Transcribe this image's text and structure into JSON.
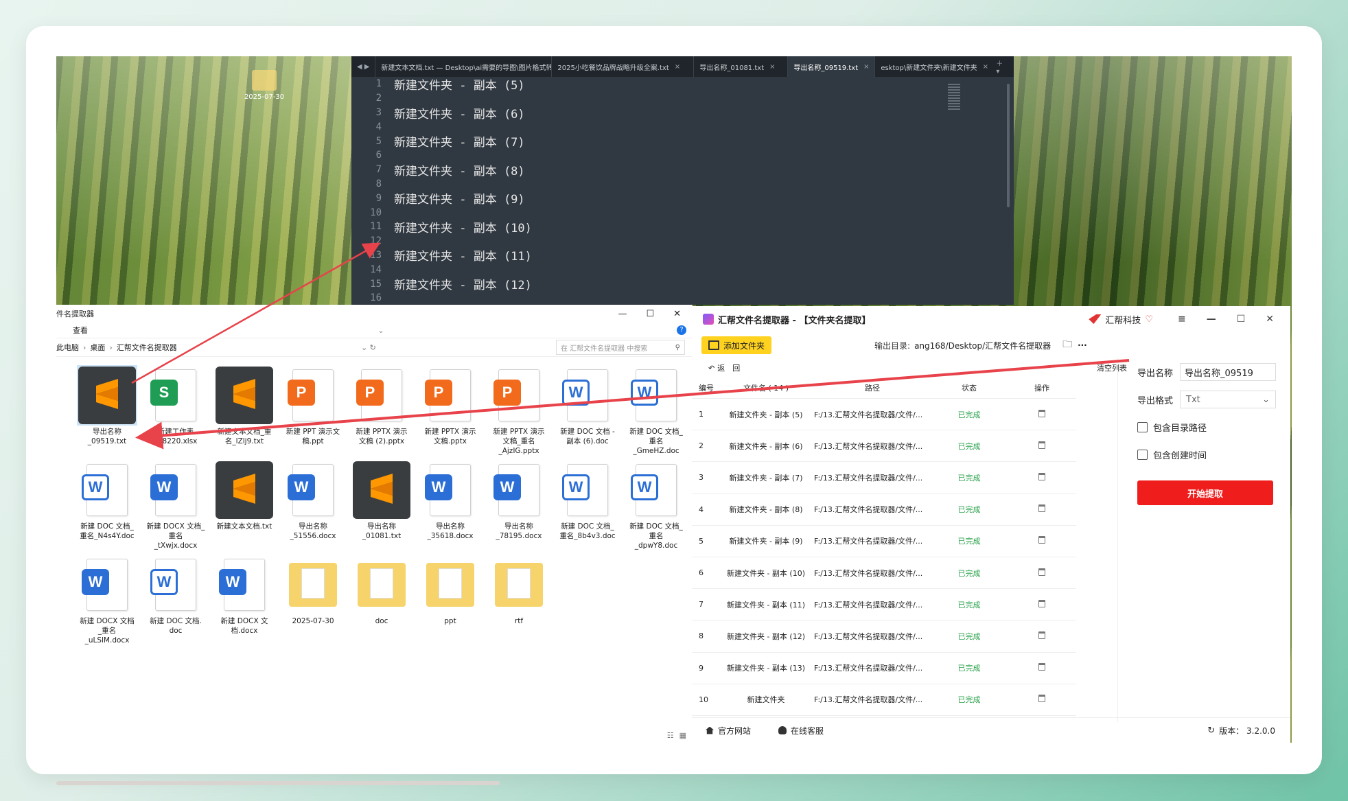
{
  "desktop": {
    "icon_label": "2025-07-30"
  },
  "editor": {
    "tabs": [
      "新建文本文档.txt — Desktop\\ai需要的导图\\图片格式转",
      "2025小吃餐饮品牌战略升级全案.txt",
      "导出名称_01081.txt",
      "导出名称_09519.txt",
      "esktop\\新建文件夹\\新建文件夹"
    ],
    "active_tab": 3,
    "lines": [
      {
        "n": "1",
        "t": "新建文件夹 - 副本 (5)"
      },
      {
        "n": "2",
        "t": ""
      },
      {
        "n": "3",
        "t": "新建文件夹 - 副本 (6)"
      },
      {
        "n": "4",
        "t": ""
      },
      {
        "n": "5",
        "t": "新建文件夹 - 副本 (7)"
      },
      {
        "n": "6",
        "t": ""
      },
      {
        "n": "7",
        "t": "新建文件夹 - 副本 (8)"
      },
      {
        "n": "8",
        "t": ""
      },
      {
        "n": "9",
        "t": "新建文件夹 - 副本 (9)"
      },
      {
        "n": "10",
        "t": ""
      },
      {
        "n": "11",
        "t": "新建文件夹 - 副本 (10)"
      },
      {
        "n": "12",
        "t": ""
      },
      {
        "n": "13",
        "t": "新建文件夹 - 副本 (11)"
      },
      {
        "n": "14",
        "t": ""
      },
      {
        "n": "15",
        "t": "新建文件夹 - 副本 (12)"
      },
      {
        "n": "16",
        "t": ""
      }
    ]
  },
  "explorer": {
    "title": "件名提取器",
    "menu_view": "查看",
    "breadcrumb": [
      "此电脑",
      "桌面",
      "汇帮文件名提取器"
    ],
    "search_placeholder": "在 汇帮文件名提取器 中搜索",
    "files": [
      {
        "kind": "sublime",
        "name": "导出名称\n_09519.txt",
        "selected": true
      },
      {
        "kind": "s",
        "name": "新建工作表\n_28220.xlsx"
      },
      {
        "kind": "sublime",
        "name": "新建文本文档_重\n名_lZlj9.txt"
      },
      {
        "kind": "p",
        "name": "新建 PPT 演示文\n稿.ppt"
      },
      {
        "kind": "p",
        "name": "新建 PPTX 演示\n文稿 (2).pptx"
      },
      {
        "kind": "p",
        "name": "新建 PPTX 演示\n文稿.pptx"
      },
      {
        "kind": "p",
        "name": "新建 PPTX 演示\n文稿_重名\n_AjzIG.pptx"
      },
      {
        "kind": "w2",
        "name": "新建 DOC 文档 -\n副本 (6).doc"
      },
      {
        "kind": "w2",
        "name": "新建 DOC 文档_\n重名\n_GmeHZ.doc"
      },
      {
        "kind": "w2",
        "name": "新建 DOC 文档_\n重名_N4s4Y.doc"
      },
      {
        "kind": "w",
        "name": "新建 DOCX 文档_\n重名\n_tXwjx.docx"
      },
      {
        "kind": "sublime",
        "name": "新建文本文档.txt"
      },
      {
        "kind": "w",
        "name": "导出名称\n_51556.docx"
      },
      {
        "kind": "sublime",
        "name": "导出名称\n_01081.txt"
      },
      {
        "kind": "w",
        "name": "导出名称\n_35618.docx"
      },
      {
        "kind": "w",
        "name": "导出名称\n_78195.docx"
      },
      {
        "kind": "w2",
        "name": "新建 DOC 文档_\n重名_8b4v3.doc"
      },
      {
        "kind": "w2",
        "name": "新建 DOC 文档_\n重名\n_dpwY8.doc"
      },
      {
        "kind": "w",
        "name": "新建 DOCX 文档\n_重名\n_uLSlM.docx"
      },
      {
        "kind": "w2",
        "name": "新建 DOC 文档.\ndoc"
      },
      {
        "kind": "w",
        "name": "新建 DOCX 文\n档.docx"
      },
      {
        "kind": "folder",
        "name": "2025-07-30"
      },
      {
        "kind": "folder",
        "name": "doc"
      },
      {
        "kind": "folder",
        "name": "ppt"
      },
      {
        "kind": "folder",
        "name": "rtf"
      }
    ]
  },
  "app": {
    "title": "汇帮文件名提取器 - 【文件夹名提取】",
    "brand": "汇帮科技",
    "add_folder": "添加文件夹",
    "output_dir_label": "输出目录:",
    "output_dir": "ang168/Desktop/汇帮文件名提取器",
    "back": "返　回",
    "clear_list": "清空列表",
    "headers": [
      "编号",
      "文件名 ( 14 )",
      "路径",
      "状态",
      "操作"
    ],
    "rows": [
      {
        "id": "1",
        "name": "新建文件夹 - 副本 (5)",
        "path": "F:/13.汇帮文件名提取器/文件/...",
        "status": "已完成"
      },
      {
        "id": "2",
        "name": "新建文件夹 - 副本 (6)",
        "path": "F:/13.汇帮文件名提取器/文件/...",
        "status": "已完成"
      },
      {
        "id": "3",
        "name": "新建文件夹 - 副本 (7)",
        "path": "F:/13.汇帮文件名提取器/文件/...",
        "status": "已完成"
      },
      {
        "id": "4",
        "name": "新建文件夹 - 副本 (8)",
        "path": "F:/13.汇帮文件名提取器/文件/...",
        "status": "已完成"
      },
      {
        "id": "5",
        "name": "新建文件夹 - 副本 (9)",
        "path": "F:/13.汇帮文件名提取器/文件/...",
        "status": "已完成"
      },
      {
        "id": "6",
        "name": "新建文件夹 - 副本 (10)",
        "path": "F:/13.汇帮文件名提取器/文件/...",
        "status": "已完成"
      },
      {
        "id": "7",
        "name": "新建文件夹 - 副本 (11)",
        "path": "F:/13.汇帮文件名提取器/文件/...",
        "status": "已完成"
      },
      {
        "id": "8",
        "name": "新建文件夹 - 副本 (12)",
        "path": "F:/13.汇帮文件名提取器/文件/...",
        "status": "已完成"
      },
      {
        "id": "9",
        "name": "新建文件夹 - 副本 (13)",
        "path": "F:/13.汇帮文件名提取器/文件/...",
        "status": "已完成"
      },
      {
        "id": "10",
        "name": "新建文件夹",
        "path": "F:/13.汇帮文件名提取器/文件/...",
        "status": "已完成"
      }
    ],
    "export_name_label": "导出名称",
    "export_name_value": "导出名称_09519",
    "export_format_label": "导出格式",
    "export_format_value": "Txt",
    "include_dir": "包含目录路径",
    "include_time": "包含创建时间",
    "start": "开始提取",
    "official_site": "官方网站",
    "online_service": "在线客服",
    "version": "版本： 3.2.0.0"
  }
}
